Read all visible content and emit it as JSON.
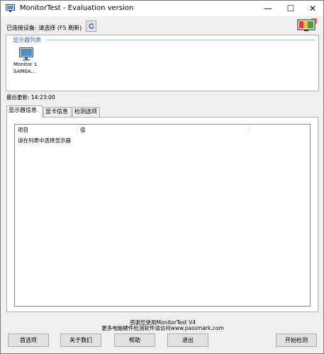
{
  "window": {
    "title": "MonitorTest - Evaluation version",
    "minimize_glyph": "—",
    "maximize_glyph": "☐",
    "close_glyph": "✕"
  },
  "device": {
    "label": "已连接设备: 请选择 (F5 刷新)",
    "refresh_icon": "refresh-icon"
  },
  "monitor_list": {
    "title": "显示器列表",
    "items": [
      {
        "name": "Monitor 1",
        "model": "SAM0A..."
      }
    ]
  },
  "last_update": "最后更新: 14:23:00",
  "tabs": [
    {
      "label": "显示器信息",
      "active": true
    },
    {
      "label": "显卡信息",
      "active": false
    },
    {
      "label": "检测选项",
      "active": false
    }
  ],
  "info_table": {
    "columns": [
      "项目",
      "值"
    ],
    "rows": [
      [
        "请在列表中选择显示器",
        ""
      ]
    ]
  },
  "footer": {
    "thanks_line1": "感谢您使用MonitorTest V4",
    "thanks_line2": "更多电脑硬件检测软件请访问www.passmark.com"
  },
  "buttons": {
    "prefs": "首选项",
    "about": "关于我们",
    "help": "帮助",
    "exit": "退出",
    "start": "开始检测"
  },
  "colors": {
    "accent": "#2a67c9",
    "window_bg": "#f0f0f0"
  }
}
